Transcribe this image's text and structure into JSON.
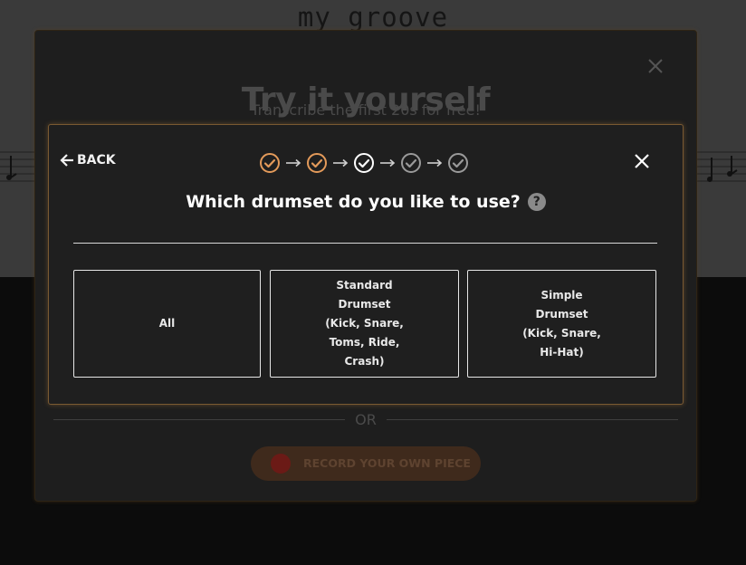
{
  "background": {
    "title": "my_groove"
  },
  "outer_modal": {
    "heading": "Try it yourself",
    "subheading": "Transcribe the first 20s for free!",
    "or_label": "OR",
    "record_button_label": "RECORD YOUR OWN PIECE"
  },
  "dialog": {
    "back_label": "BACK",
    "question": "Which drumset do you like to use?",
    "help_icon": "question-mark-icon",
    "steps": [
      {
        "state": "completed",
        "color": "#e39a5a"
      },
      {
        "state": "completed",
        "color": "#e39a5a"
      },
      {
        "state": "current",
        "color": "#ffffff"
      },
      {
        "state": "upcoming",
        "color": "#9a9a9a"
      },
      {
        "state": "upcoming",
        "color": "#9a9a9a"
      }
    ],
    "options": [
      {
        "label": "All"
      },
      {
        "label": "Standard Drumset (Kick, Snare, Toms, Ride, Crash)"
      },
      {
        "label": "Simple Drumset (Kick, Snare, Hi-Hat)"
      }
    ]
  },
  "colors": {
    "accent": "#e39a5a",
    "modal_border": "#7a5a32",
    "record_dot": "#6b1a16"
  }
}
